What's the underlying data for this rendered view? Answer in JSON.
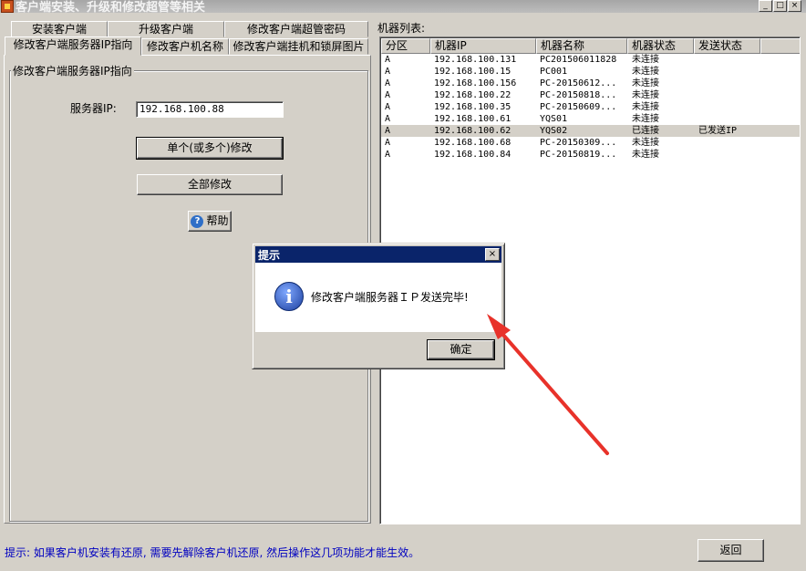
{
  "window": {
    "title": "客户端安装、升级和修改超管等相关",
    "minimize_glyph": "_",
    "maximize_glyph": "□",
    "close_glyph": "×"
  },
  "tabs": {
    "row1": [
      "安装客户端",
      "升级客户端",
      "修改客户端超管密码"
    ],
    "row2": [
      "修改客户端服务器IP指向",
      "修改客户机名称",
      "修改客户端挂机和锁屏图片"
    ]
  },
  "panel": {
    "group_title": "修改客户端服务器IP指向",
    "server_ip_label": "服务器IP:",
    "server_ip_value": "192.168.100.88",
    "single_modify_button": "单个(或多个)修改",
    "modify_all_button": "全部修改",
    "help_button": "帮助",
    "help_icon_glyph": "?"
  },
  "machine_list": {
    "label": "机器列表:",
    "columns": [
      "分区",
      "机器IP",
      "机器名称",
      "机器状态",
      "发送状态"
    ],
    "rows": [
      [
        "A",
        "192.168.100.131",
        "PC201506011828",
        "未连接",
        ""
      ],
      [
        "A",
        "192.168.100.15",
        "PC001",
        "未连接",
        ""
      ],
      [
        "A",
        "192.168.100.156",
        "PC-20150612...",
        "未连接",
        ""
      ],
      [
        "A",
        "192.168.100.22",
        "PC-20150818...",
        "未连接",
        ""
      ],
      [
        "A",
        "192.168.100.35",
        "PC-20150609...",
        "未连接",
        ""
      ],
      [
        "A",
        "192.168.100.61",
        "YQS01",
        "未连接",
        ""
      ],
      [
        "A",
        "192.168.100.62",
        "YQS02",
        "已连接",
        "已发送IP"
      ],
      [
        "A",
        "192.168.100.68",
        "PC-20150309...",
        "未连接",
        ""
      ],
      [
        "A",
        "192.168.100.84",
        "PC-20150819...",
        "未连接",
        ""
      ]
    ],
    "selected_row": 6
  },
  "footer": {
    "hint": "提示: 如果客户机安装有还原, 需要先解除客户机还原, 然后操作这几项功能才能生效。",
    "back_button": "返回"
  },
  "dialog": {
    "title": "提示",
    "close_glyph": "×",
    "info_glyph": "i",
    "message": "修改客户端服务器ＩＰ发送完毕!",
    "ok_button": "确定"
  },
  "colors": {
    "dialog_title_bar": "#0a246a",
    "hint_text": "#0000c0",
    "annotation_arrow": "#e8322a",
    "window_face": "#d4d0c8"
  }
}
